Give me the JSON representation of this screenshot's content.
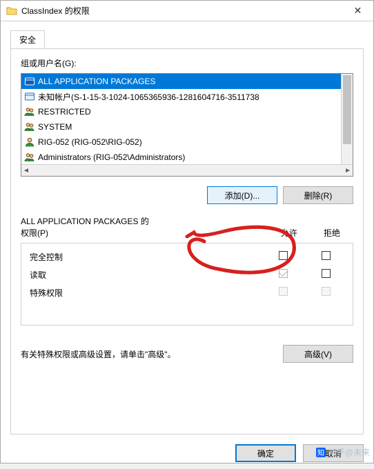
{
  "titlebar": {
    "icon": "folder-icon",
    "title": "ClassIndex 的权限",
    "close": "✕"
  },
  "tab": {
    "label": "安全"
  },
  "groups_label": "组或用户名(G):",
  "principals": [
    {
      "icon": "package-icon",
      "name": "ALL APPLICATION PACKAGES",
      "selected": true
    },
    {
      "icon": "package-icon",
      "name": "未知帐户(S-1-15-3-1024-1065365936-1281604716-3511738",
      "selected": false
    },
    {
      "icon": "users-icon",
      "name": "RESTRICTED",
      "selected": false
    },
    {
      "icon": "users-icon",
      "name": "SYSTEM",
      "selected": false
    },
    {
      "icon": "user-icon",
      "name": "RIG-052 (RIG-052\\RIG-052)",
      "selected": false
    },
    {
      "icon": "users-icon",
      "name": "Administrators (RIG-052\\Administrators)",
      "selected": false
    }
  ],
  "buttons": {
    "add": "添加(D)...",
    "remove": "删除(R)"
  },
  "perm_for_label_prefix": "ALL APPLICATION PACKAGES 的",
  "perm_for_label_suffix": "权限(P)",
  "col_allow": "允许",
  "col_deny": "拒绝",
  "permissions": [
    {
      "name": "完全控制",
      "allow": "unchecked",
      "deny": "unchecked"
    },
    {
      "name": "读取",
      "allow": "checked-disabled",
      "deny": "unchecked"
    },
    {
      "name": "特殊权限",
      "allow": "disabled-empty",
      "deny": "disabled-empty"
    }
  ],
  "advanced_text": "有关特殊权限或高级设置，请单击\"高级\"。",
  "advanced_btn": "高级(V)",
  "ok": "确定",
  "cancel": "取消",
  "watermark": "知乎@未来"
}
